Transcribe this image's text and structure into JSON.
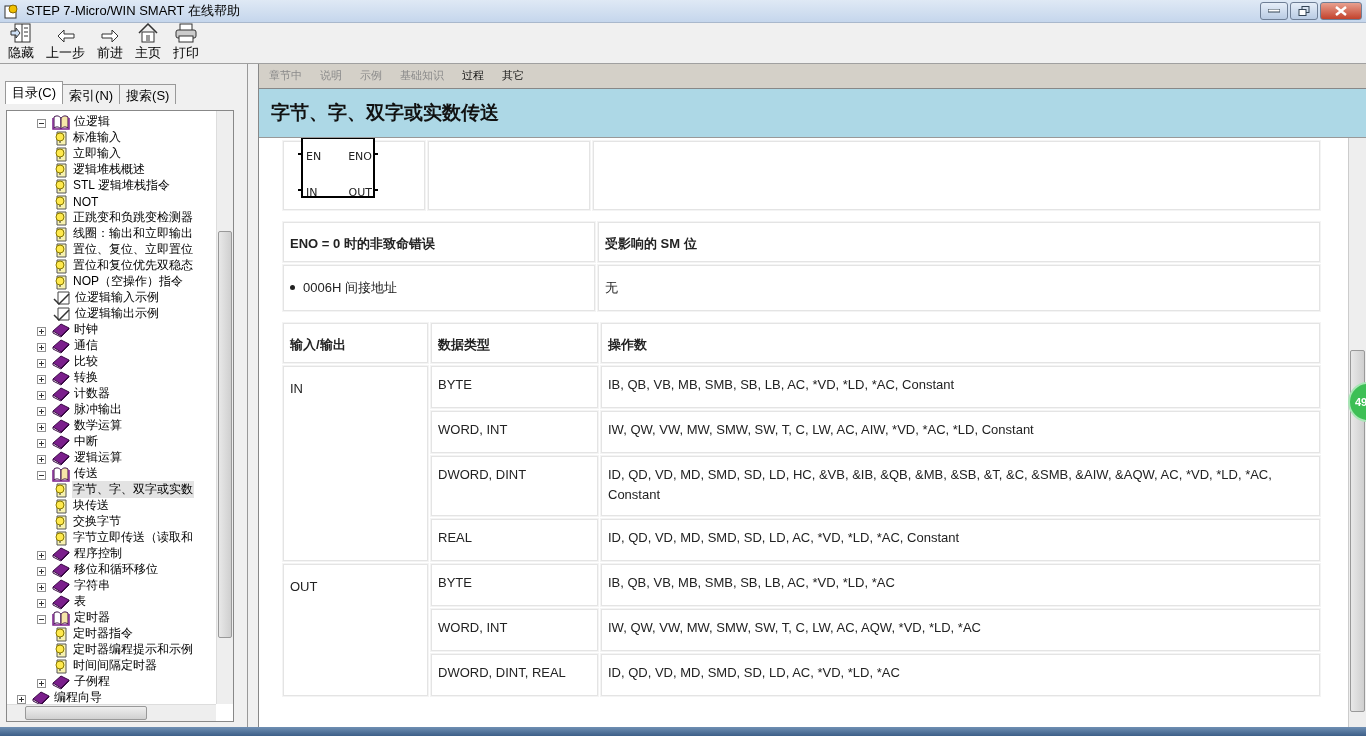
{
  "window": {
    "title": "STEP 7-Micro/WIN SMART 在线帮助"
  },
  "toolbar": [
    {
      "label": "隐藏",
      "kind": "hide"
    },
    {
      "label": "上一步",
      "kind": "back"
    },
    {
      "label": "前进",
      "kind": "forward"
    },
    {
      "label": "主页",
      "kind": "home"
    },
    {
      "label": "打印",
      "kind": "print"
    }
  ],
  "nav_tabs": [
    {
      "label": "目录(C)",
      "selected": true
    },
    {
      "label": "索引(N)",
      "selected": false
    },
    {
      "label": "搜索(S)",
      "selected": false
    }
  ],
  "tree": {
    "items": [
      {
        "label": "位逻辑",
        "kind": "book",
        "expanded": true,
        "children": [
          {
            "label": "标准输入",
            "kind": "page",
            "selected": false
          },
          {
            "label": "立即输入",
            "kind": "page",
            "selected": false
          },
          {
            "label": "逻辑堆栈概述",
            "kind": "page",
            "selected": false
          },
          {
            "label": "STL 逻辑堆栈指令",
            "kind": "page",
            "selected": false
          },
          {
            "label": "NOT",
            "kind": "page",
            "selected": false
          },
          {
            "label": "正跳变和负跳变检测器",
            "kind": "page",
            "selected": false
          },
          {
            "label": "线圈：输出和立即输出",
            "kind": "page",
            "selected": false
          },
          {
            "label": "置位、复位、立即置位",
            "kind": "page",
            "selected": false
          },
          {
            "label": "置位和复位优先双稳态",
            "kind": "page",
            "selected": false
          },
          {
            "label": "NOP（空操作）指令",
            "kind": "page",
            "selected": false
          },
          {
            "label": "位逻辑输入示例",
            "kind": "example",
            "selected": false
          },
          {
            "label": "位逻辑输出示例",
            "kind": "example",
            "selected": false
          }
        ]
      },
      {
        "label": "时钟",
        "kind": "book",
        "expanded": false
      },
      {
        "label": "通信",
        "kind": "book",
        "expanded": false
      },
      {
        "label": "比较",
        "kind": "book",
        "expanded": false
      },
      {
        "label": "转换",
        "kind": "book",
        "expanded": false
      },
      {
        "label": "计数器",
        "kind": "book",
        "expanded": false
      },
      {
        "label": "脉冲输出",
        "kind": "book",
        "expanded": false
      },
      {
        "label": "数学运算",
        "kind": "book",
        "expanded": false
      },
      {
        "label": "中断",
        "kind": "book",
        "expanded": false
      },
      {
        "label": "逻辑运算",
        "kind": "book",
        "expanded": false
      },
      {
        "label": "传送",
        "kind": "book",
        "expanded": true,
        "children": [
          {
            "label": "字节、字、双字或实数",
            "kind": "page",
            "selected": true
          },
          {
            "label": "块传送",
            "kind": "page",
            "selected": false
          },
          {
            "label": "交换字节",
            "kind": "page",
            "selected": false
          },
          {
            "label": "字节立即传送（读取和",
            "kind": "page",
            "selected": false
          }
        ]
      },
      {
        "label": "程序控制",
        "kind": "book",
        "expanded": false
      },
      {
        "label": "移位和循环移位",
        "kind": "book",
        "expanded": false
      },
      {
        "label": "字符串",
        "kind": "book",
        "expanded": false
      },
      {
        "label": "表",
        "kind": "book",
        "expanded": false
      },
      {
        "label": "定时器",
        "kind": "book",
        "expanded": true,
        "children": [
          {
            "label": "定时器指令",
            "kind": "page",
            "selected": false
          },
          {
            "label": "定时器编程提示和示例",
            "kind": "page",
            "selected": false
          },
          {
            "label": "时间间隔定时器",
            "kind": "page",
            "selected": false
          }
        ]
      },
      {
        "label": "子例程",
        "kind": "book",
        "expanded": false
      }
    ],
    "root_items": [
      {
        "label": "编程向导",
        "kind": "book",
        "expanded": false
      }
    ]
  },
  "topic_nav": [
    {
      "label": "章节中",
      "disabled": true
    },
    {
      "label": "说明",
      "disabled": true
    },
    {
      "label": "示例",
      "disabled": true
    },
    {
      "label": "基础知识",
      "disabled": true
    },
    {
      "label": "过程",
      "disabled": false
    },
    {
      "label": "其它",
      "disabled": false
    }
  ],
  "topic_title": "字节、字、双字或实数传送",
  "diagram": {
    "pins": [
      "EN",
      "ENO",
      "IN",
      "OUT"
    ]
  },
  "error_table": {
    "columns": [
      "ENO = 0 时的非致命错误",
      "受影响的 SM 位"
    ],
    "rows": [
      {
        "error": "0006H 间接地址",
        "sm_bits": "无"
      }
    ]
  },
  "operand_table": {
    "columns": [
      "输入/输出",
      "数据类型",
      "操作数"
    ],
    "groups": [
      {
        "io": "IN",
        "rows": [
          {
            "type": "BYTE",
            "operands": "IB, QB, VB, MB, SMB, SB, LB, AC, *VD, *LD, *AC, Constant"
          },
          {
            "type": "WORD, INT",
            "operands": "IW, QW, VW, MW, SMW, SW, T, C, LW, AC, AIW, *VD, *AC, *LD, Constant"
          },
          {
            "type": "DWORD, DINT",
            "operands": "ID, QD, VD, MD, SMD, SD, LD, HC, &VB, &IB, &QB, &MB, &SB, &T, &C, &SMB, &AIW, &AQW, AC, *VD, *LD, *AC, Constant"
          },
          {
            "type": "REAL",
            "operands": "ID, QD, VD, MD, SMD, SD, LD, AC, *VD, *LD, *AC, Constant"
          }
        ]
      },
      {
        "io": "OUT",
        "rows": [
          {
            "type": "BYTE",
            "operands": "IB, QB, VB, MB, SMB, SB, LB, AC, *VD, *LD, *AC"
          },
          {
            "type": "WORD, INT",
            "operands": "IW, QW, VW, MW, SMW, SW, T, C, LW, AC, AQW, *VD, *LD, *AC"
          },
          {
            "type": "DWORD, DINT, REAL",
            "operands": "ID, QD, VD, MD, SMD, SD, LD, AC, *VD, *LD, *AC"
          }
        ]
      }
    ]
  },
  "badge": "49"
}
